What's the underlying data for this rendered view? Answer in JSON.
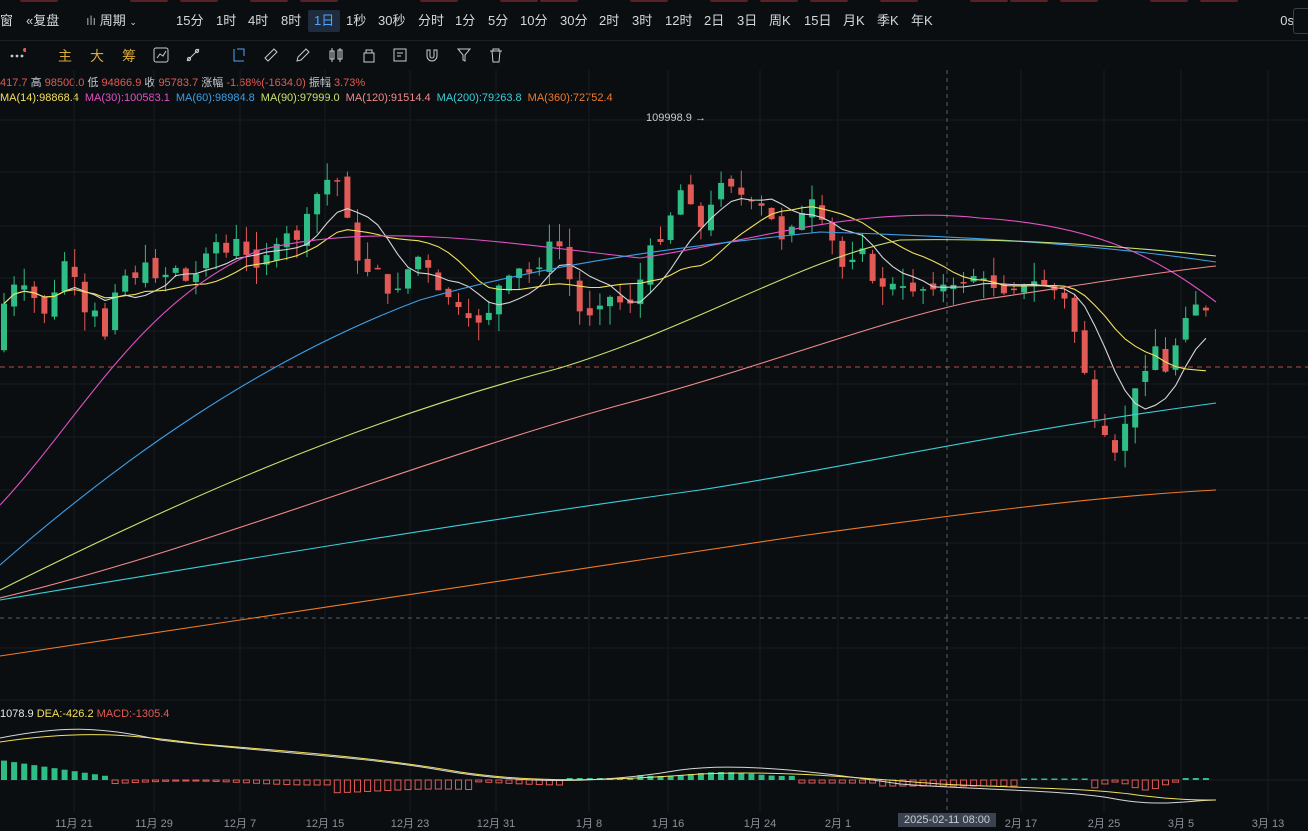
{
  "toolbar": {
    "window_label": "窗",
    "restore_label": "复盘",
    "period_label": "周期",
    "intervals": [
      "15分",
      "1时",
      "4时",
      "8时",
      "1日",
      "1秒",
      "30秒",
      "分时",
      "1分",
      "5分",
      "10分",
      "30分",
      "2时",
      "3时",
      "12时",
      "2日",
      "3日",
      "周K",
      "15日",
      "月K",
      "季K",
      "年K"
    ],
    "active_interval": "1日",
    "countdown": "0s"
  },
  "toolbar2": {
    "main_label": "主",
    "big_label": "大",
    "chip_label": "筹",
    "tool_icons": [
      "dots-menu-icon",
      "indicator-icon",
      "draw-tool-icon",
      "crosshair-icon",
      "ruler-icon",
      "pencil-icon",
      "candle-type-icon",
      "lock-icon",
      "note-icon",
      "magnet-icon",
      "filter-icon",
      "trash-icon"
    ]
  },
  "ohlc": {
    "open_partial": "417.7",
    "high_label": "高",
    "high": "98500.0",
    "low_label": "低",
    "low": "94866.9",
    "close_label": "收",
    "close": "95783.7",
    "change_label": "涨幅",
    "change": "-1.68%(-1634.0)",
    "amp_label": "振幅",
    "amp": "3.73%"
  },
  "ma_legend": [
    {
      "text": "MA(14):98868.4",
      "color": "#f1e05a"
    },
    {
      "text": "MA(30):100583.1",
      "color": "#e051c4"
    },
    {
      "text": "MA(60):98984.8",
      "color": "#3d9ee6"
    },
    {
      "text": "MA(90):97999.0",
      "color": "#c8e36d"
    },
    {
      "text": "MA(120):91514.4",
      "color": "#f08a8a"
    },
    {
      "text": "MA(200):79263.8",
      "color": "#3ad0d8"
    },
    {
      "text": "MA(360):72752.4",
      "color": "#ef7a2a"
    }
  ],
  "macd_legend": {
    "dif": "1078.9",
    "dea": "DEA:-426.2",
    "macd": "MACD:-1305.4"
  },
  "peak_label": "109998.9",
  "crosshair_date": "2025-02-11 08:00",
  "chart_data": {
    "type": "candlestick",
    "price_range": [
      70000,
      112000
    ],
    "x_ticks": [
      "11月 21",
      "11月 29",
      "12月 7",
      "12月 15",
      "12月 23",
      "12月 31",
      "1月 8",
      "1月 16",
      "1月 24",
      "2月 1",
      "2月 17",
      "2月 25",
      "3月 5",
      "3月 13"
    ],
    "last_price_line": 95783.7,
    "ma_series": [
      "MA(14)",
      "MA(30)",
      "MA(60)",
      "MA(90)",
      "MA(120)",
      "MA(200)",
      "MA(360)"
    ],
    "macd_panel": [
      "DIF",
      "DEA",
      "MACD"
    ],
    "up_color": "#2ebd85",
    "down_color": "#e15a55"
  }
}
